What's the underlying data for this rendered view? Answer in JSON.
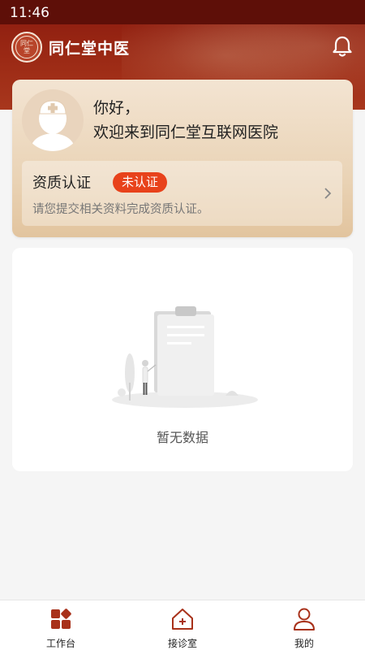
{
  "status_bar": {
    "time": "11:46"
  },
  "header": {
    "brand": "同仁堂中医",
    "seal_text": "同仁堂"
  },
  "profile": {
    "greeting_line1": "你好，",
    "greeting_line2": "欢迎来到同仁堂互联网医院",
    "certification": {
      "title": "资质认证",
      "badge": "未认证",
      "description": "请您提交相关资料完成资质认证。"
    }
  },
  "empty_state": {
    "message": "暂无数据"
  },
  "tabbar": {
    "tabs": [
      {
        "label": "工作台",
        "icon": "grid-icon",
        "active": true
      },
      {
        "label": "接诊室",
        "icon": "house-plus-icon",
        "active": false
      },
      {
        "label": "我的",
        "icon": "person-icon",
        "active": false
      }
    ]
  },
  "colors": {
    "brand": "#8a1a0e",
    "accent": "#e8421b",
    "icon": "#a8311a"
  }
}
